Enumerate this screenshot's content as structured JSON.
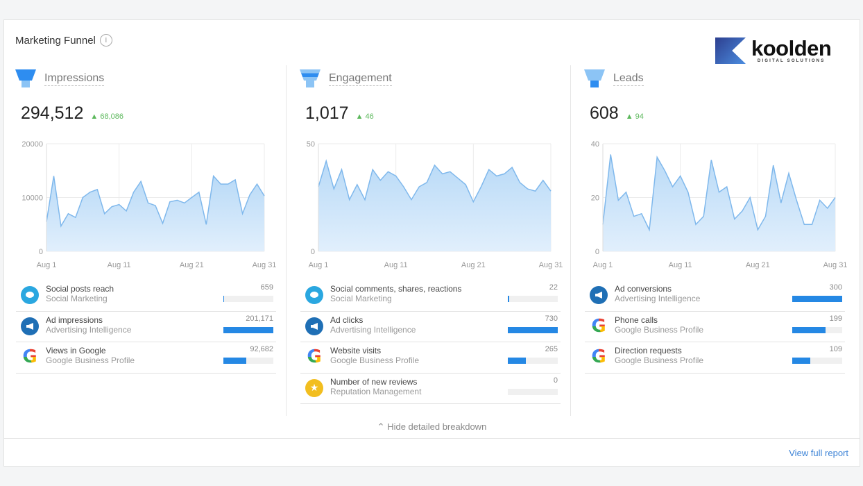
{
  "title": "Marketing Funnel",
  "info_icon": "info-icon",
  "logo": {
    "name": "koolden",
    "tagline": "DIGITAL SOLUTIONS"
  },
  "colors": {
    "accent": "#2588e4",
    "line": "#7fb8ec",
    "fill": "#d6e9fb",
    "delta": "#5cb85c",
    "link": "#3b82d6"
  },
  "columns": [
    {
      "name": "Impressions",
      "total": "294,512",
      "delta": "68,086",
      "rows": [
        {
          "label": "Social posts reach",
          "source": "Social Marketing",
          "value": "659",
          "icon": "social"
        },
        {
          "label": "Ad impressions",
          "source": "Advertising Intelligence",
          "value": "201,171",
          "icon": "ad"
        },
        {
          "label": "Views in Google",
          "source": "Google Business Profile",
          "value": "92,682",
          "icon": "google"
        }
      ]
    },
    {
      "name": "Engagement",
      "total": "1,017",
      "delta": "46",
      "rows": [
        {
          "label": "Social comments, shares, reactions",
          "source": "Social Marketing",
          "value": "22",
          "icon": "social"
        },
        {
          "label": "Ad clicks",
          "source": "Advertising Intelligence",
          "value": "730",
          "icon": "ad"
        },
        {
          "label": "Website visits",
          "source": "Google Business Profile",
          "value": "265",
          "icon": "google"
        },
        {
          "label": "Number of new reviews",
          "source": "Reputation Management",
          "value": "0",
          "icon": "star"
        }
      ]
    },
    {
      "name": "Leads",
      "total": "608",
      "delta": "94",
      "rows": [
        {
          "label": "Ad conversions",
          "source": "Advertising Intelligence",
          "value": "300",
          "icon": "ad"
        },
        {
          "label": "Phone calls",
          "source": "Google Business Profile",
          "value": "199",
          "icon": "google"
        },
        {
          "label": "Direction requests",
          "source": "Google Business Profile",
          "value": "109",
          "icon": "google"
        }
      ]
    }
  ],
  "chart_data": [
    {
      "type": "area",
      "x_ticks": [
        "Aug 1",
        "Aug 11",
        "Aug 21",
        "Aug 31"
      ],
      "y_ticks": [
        "0",
        "10000",
        "20000"
      ],
      "ylim": [
        0,
        20000
      ],
      "grid": true,
      "x": "Aug 1 – Aug 31 (daily)",
      "values": [
        5500,
        14000,
        4700,
        7000,
        6300,
        10000,
        11000,
        11500,
        7000,
        8300,
        8700,
        7500,
        11000,
        13000,
        9000,
        8500,
        5200,
        9200,
        9500,
        9000,
        10000,
        11000,
        5000,
        14000,
        12500,
        12500,
        13300,
        7000,
        10500,
        12500,
        10300
      ]
    },
    {
      "type": "area",
      "x_ticks": [
        "Aug 1",
        "Aug 11",
        "Aug 21",
        "Aug 31"
      ],
      "y_ticks": [
        "0",
        "50"
      ],
      "ylim": [
        0,
        50
      ],
      "grid": true,
      "values": [
        30,
        42,
        29,
        38,
        24,
        31,
        24,
        38,
        33,
        37,
        35,
        30,
        24,
        30,
        32,
        40,
        36,
        37,
        34,
        31,
        23,
        30,
        38,
        35,
        36,
        39,
        32,
        29,
        28,
        33,
        28
      ]
    },
    {
      "type": "area",
      "x_ticks": [
        "Aug 1",
        "Aug 11",
        "Aug 21",
        "Aug 31"
      ],
      "y_ticks": [
        "0",
        "20",
        "40"
      ],
      "ylim": [
        0,
        40
      ],
      "grid": true,
      "values": [
        10,
        36,
        19,
        22,
        13,
        14,
        8,
        35,
        30,
        24,
        28,
        22,
        10,
        13,
        34,
        22,
        24,
        12,
        15,
        20,
        8,
        13,
        32,
        18,
        29,
        19,
        10,
        10,
        19,
        16,
        20
      ]
    }
  ],
  "hide_breakdown": "Hide detailed breakdown",
  "view_full_report": "View full report"
}
